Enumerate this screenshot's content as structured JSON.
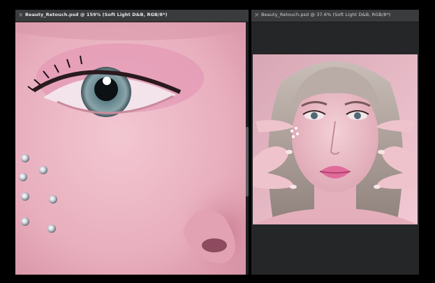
{
  "left_document": {
    "tab_title": "Beauty_Retouch.psd @ 159% (Soft Light D&B, RGB/8*)",
    "close_glyph": "×",
    "image": "close-up of eye, pink eyeshadow, rhinestones on cheek, nose"
  },
  "right_document": {
    "tab_title": "Beauty_Retouch.psd @ 37.6% (Soft Light D&B, RGB/8*)",
    "close_glyph": "×",
    "image": "portrait of woman with platinum bob, hands framing face, pink glossy lips"
  },
  "colors": {
    "app_background": "#000000",
    "panel": "#2b2c2e",
    "tab": "#3a3b3d",
    "skin": "#e9aebd"
  }
}
